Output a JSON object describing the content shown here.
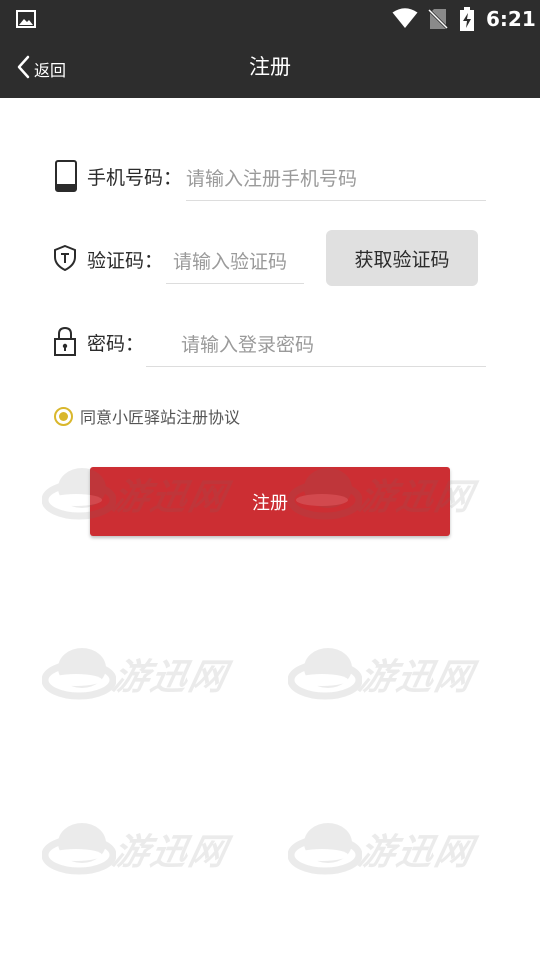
{
  "status_bar": {
    "time": "6:21",
    "icons": [
      "image-icon",
      "wifi-icon",
      "no-sim-icon",
      "battery-charging-icon"
    ]
  },
  "nav": {
    "back_label": "返回",
    "title": "注册"
  },
  "form": {
    "phone": {
      "label": "手机号码：",
      "placeholder": "请输入注册手机号码",
      "value": "",
      "icon": "phone-icon"
    },
    "code": {
      "label": "验证码：",
      "placeholder": "请输入验证码",
      "value": "",
      "icon": "shield-icon",
      "button_label": "获取验证码"
    },
    "password": {
      "label": "密码：",
      "placeholder": "请输入登录密码",
      "value": "",
      "icon": "lock-icon"
    }
  },
  "agreement": {
    "label": "同意小匠驿站注册协议",
    "checked": true
  },
  "submit_label": "注册",
  "watermark_text": "游迅网",
  "colors": {
    "bar_background": "#2d2d2d",
    "primary_button": "#cc2e33",
    "secondary_button": "#e0e0e0",
    "radio_accent": "#d9b72c"
  }
}
